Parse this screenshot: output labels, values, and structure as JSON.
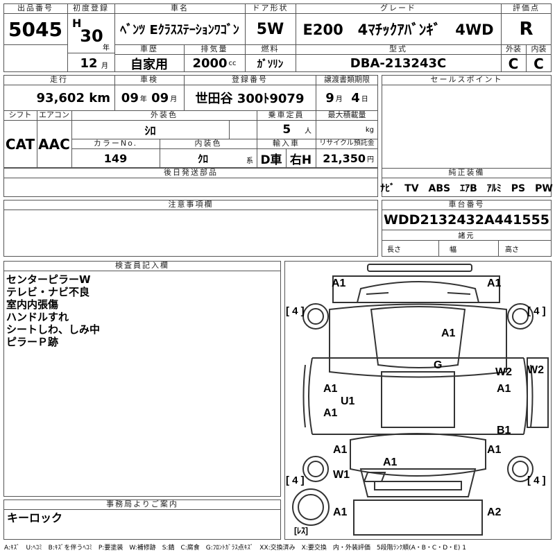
{
  "header": {
    "lot_label": "出品番号",
    "lot": "5045",
    "first_reg_label": "初度登録",
    "era": "H",
    "year": "30",
    "year_unit": "年",
    "month": "12",
    "month_unit": "月",
    "name_label": "車名",
    "name": "ﾍﾞﾝﾂ Eｸﾗｽｽﾃｰｼｮﾝﾜｺﾞﾝ",
    "door_label": "ドア形状",
    "door": "5W",
    "grade_label": "グレード",
    "grade": "E200　4ﾏﾁｯｸｱﾊﾞﾝｷﾞ　4WD",
    "score_label": "評価点",
    "score": "R",
    "history_label": "車歴",
    "history": "自家用",
    "displacement_label": "排気量",
    "displacement": "2000",
    "displacement_unit": "cc",
    "fuel_label": "燃料",
    "fuel": "ｶﾞｿﾘﾝ",
    "model_label": "型式",
    "model": "DBA-213243C",
    "ext_label": "外装",
    "ext": "C",
    "int_label": "内装",
    "int": "C"
  },
  "specs": {
    "mileage_label": "走行",
    "mileage": "93,602",
    "mileage_unit": "km",
    "inspection_label": "車検",
    "insp_year": "09",
    "insp_year_unit": "年",
    "insp_month": "09",
    "insp_month_unit": "月",
    "plate_label": "登録番号",
    "plate": "世田谷 300ﾄ9079",
    "transfer_label": "譲渡書類期限",
    "transfer_month": "9",
    "transfer_month_unit": "月",
    "transfer_day": "4",
    "transfer_day_unit": "日",
    "shift_label": "シフト",
    "shift": "CAT",
    "ac_label": "エアコン",
    "ac": "AAC",
    "color_label": "外装色",
    "color": "ｼﾛ",
    "capacity_label": "乗車定員",
    "capacity": "5",
    "capacity_unit": "人",
    "load_label": "最大積載量",
    "load_unit": "kg",
    "color_no_label": "カラーNo.",
    "color_no": "149",
    "int_color_label": "内装色",
    "int_color": "ｸﾛ",
    "int_color_unit": "系",
    "import_label": "輸入車",
    "import_car": "D車",
    "handle": "右H",
    "recycle_label": "リサイクル預託金",
    "recycle": "21,350",
    "recycle_unit": "円",
    "later_label": "後日発送部品",
    "sales_label": "セールスポイント",
    "equip_label": "純正装備",
    "equip": "ﾅﾋﾞ　TV　ABS　ｴｱB　ｱﾙﾐ　PS　PW",
    "caution_label": "注意事項欄",
    "chassis_label": "車台番号",
    "chassis": "WDD2132432A441555",
    "dims_label": "諸元",
    "length_label": "長さ",
    "width_label": "幅",
    "height_label": "高さ"
  },
  "inspector": {
    "title": "検査員記入欄",
    "notes": [
      "センターピラーW",
      "テレビ・ナビ不良",
      "室内内張傷",
      "ハンドルすれ",
      "シートしわ、しみ中",
      "ピラーＰ跡"
    ]
  },
  "office": {
    "title": "事務局よりご案内",
    "note": "キーロック"
  },
  "diagram": {
    "labels": [
      "A1",
      "A1",
      "A1",
      "G",
      "W2",
      "W2",
      "A1",
      "A1",
      "U1",
      "A1",
      "B1",
      "A1",
      "A1",
      "A1",
      "W1",
      "A1",
      "A2"
    ],
    "tires": [
      "[ 4 ]",
      "[ 4 ]",
      "[ 4 ]",
      "[ 4 ]"
    ],
    "spare": "[ﾚｽ]"
  },
  "legend": "A:ｷｽﾞ　U:ﾍｺﾐ　B:ｷｽﾞを伴うﾍｺﾐ　P:要塗装　W:補修跡　S:錆　C:腐食　G:ﾌﾛﾝﾄｶﾞﾗｽ点ｷｽﾞ　XX:交換済み　X:要交換　内・外装評価　5段階ﾗﾝｸ順(A・B・C・D・E) 1"
}
